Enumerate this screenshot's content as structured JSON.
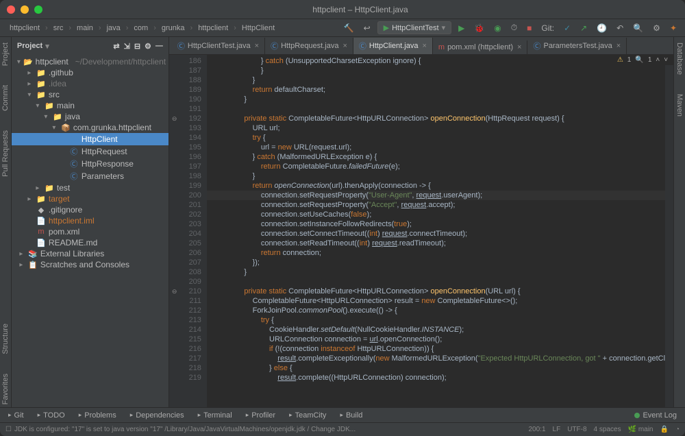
{
  "title": "httpclient – HttpClient.java",
  "breadcrumbs": [
    "httpclient",
    "src",
    "main",
    "java",
    "com",
    "grunka",
    "httpclient",
    "HttpClient"
  ],
  "run_config": "HttpClientTest",
  "git_label": "Git:",
  "left_gutter": [
    "Project",
    "Commit",
    "Pull Requests"
  ],
  "right_gutter": [
    "Database",
    "Maven"
  ],
  "left_gutter_lower": [
    "Favorites",
    "Structure"
  ],
  "sidebar": {
    "header": "Project",
    "tree": [
      {
        "depth": 0,
        "arrow": "▾",
        "icon": "📂",
        "label": "httpclient",
        "suffix": "~/Development/httpclient",
        "cls": "bold"
      },
      {
        "depth": 1,
        "arrow": "▸",
        "icon": "📁",
        "label": ".github"
      },
      {
        "depth": 1,
        "arrow": "▸",
        "icon": "📁",
        "label": ".idea",
        "dim": true
      },
      {
        "depth": 1,
        "arrow": "▾",
        "icon": "📁",
        "label": "src"
      },
      {
        "depth": 2,
        "arrow": "▾",
        "icon": "📁",
        "label": "main"
      },
      {
        "depth": 3,
        "arrow": "▾",
        "icon": "📁",
        "label": "java",
        "blue": true
      },
      {
        "depth": 4,
        "arrow": "▾",
        "icon": "📦",
        "label": "com.grunka.httpclient"
      },
      {
        "depth": 5,
        "arrow": "",
        "icon": "Ⓒ",
        "label": "HttpClient",
        "selected": true
      },
      {
        "depth": 5,
        "arrow": "",
        "icon": "Ⓒ",
        "label": "HttpRequest"
      },
      {
        "depth": 5,
        "arrow": "",
        "icon": "Ⓒ",
        "label": "HttpResponse"
      },
      {
        "depth": 5,
        "arrow": "",
        "icon": "Ⓒ",
        "label": "Parameters"
      },
      {
        "depth": 2,
        "arrow": "▸",
        "icon": "📁",
        "label": "test"
      },
      {
        "depth": 1,
        "arrow": "▸",
        "icon": "📁",
        "label": "target",
        "orange": true
      },
      {
        "depth": 1,
        "arrow": "",
        "icon": "◆",
        "label": ".gitignore"
      },
      {
        "depth": 1,
        "arrow": "",
        "icon": "📄",
        "label": "httpclient.iml",
        "orange": true
      },
      {
        "depth": 1,
        "arrow": "",
        "icon": "m",
        "label": "pom.xml"
      },
      {
        "depth": 1,
        "arrow": "",
        "icon": "📄",
        "label": "README.md"
      },
      {
        "depth": 0,
        "arrow": "▸",
        "icon": "📚",
        "label": "External Libraries"
      },
      {
        "depth": 0,
        "arrow": "▸",
        "icon": "📋",
        "label": "Scratches and Consoles"
      }
    ]
  },
  "tabs": [
    {
      "icon": "Ⓒ",
      "label": "HttpClientTest.java",
      "active": false
    },
    {
      "icon": "Ⓒ",
      "label": "HttpRequest.java",
      "active": false
    },
    {
      "icon": "Ⓒ",
      "label": "HttpClient.java",
      "active": true
    },
    {
      "icon": "m",
      "label": "pom.xml (httpclient)",
      "active": false
    },
    {
      "icon": "Ⓒ",
      "label": "ParametersTest.java",
      "active": false
    }
  ],
  "inspect": {
    "warn_count": "1",
    "search_count": "1"
  },
  "line_start": 186,
  "code": [
    {
      "n": 186,
      "txt": "                } <kw>catch</kw> (UnsupportedCharsetException ignore) {"
    },
    {
      "n": 187,
      "txt": "                }"
    },
    {
      "n": 188,
      "txt": "            }"
    },
    {
      "n": 189,
      "txt": "            <kw>return</kw> defaultCharset;"
    },
    {
      "n": 190,
      "txt": "        }"
    },
    {
      "n": 191,
      "txt": ""
    },
    {
      "n": 192,
      "fold": "⊖",
      "txt": "        <kw>private static</kw> CompletableFuture&lt;HttpURLConnection&gt; <fn>openConnection</fn>(HttpRequest request) {"
    },
    {
      "n": 193,
      "txt": "            URL url;"
    },
    {
      "n": 194,
      "txt": "            <kw>try</kw> {"
    },
    {
      "n": 195,
      "txt": "                url = <kw>new</kw> URL(request.<param>url</param>);"
    },
    {
      "n": 196,
      "txt": "            } <kw>catch</kw> (MalformedURLException e) {"
    },
    {
      "n": 197,
      "txt": "                <kw>return</kw> CompletableFuture.<it>failedFuture</it>(e);"
    },
    {
      "n": 198,
      "txt": "            }"
    },
    {
      "n": 199,
      "txt": "            <kw>return</kw> <it>openConnection</it>(url).thenApply(connection -&gt; {"
    },
    {
      "n": 200,
      "hl": true,
      "txt": "                connection.setRequestProperty(<str>\"User-Agent\"</str>, <u>request</u>.<param>userAgent</param>);"
    },
    {
      "n": 201,
      "txt": "                connection.setRequestProperty(<str>\"Accept\"</str>, <u>request</u>.<param>accept</param>);"
    },
    {
      "n": 202,
      "txt": "                connection.setUseCaches(<kw>false</kw>);"
    },
    {
      "n": 203,
      "txt": "                connection.setInstanceFollowRedirects(<kw>true</kw>);"
    },
    {
      "n": 204,
      "txt": "                connection.setConnectTimeout((<kw>int</kw>) <u>request</u>.<param>connectTimeout</param>);"
    },
    {
      "n": 205,
      "txt": "                connection.setReadTimeout((<kw>int</kw>) <u>request</u>.<param>readTimeout</param>);"
    },
    {
      "n": 206,
      "txt": "                <kw>return</kw> connection;"
    },
    {
      "n": 207,
      "txt": "            });"
    },
    {
      "n": 208,
      "txt": "        }"
    },
    {
      "n": 209,
      "txt": ""
    },
    {
      "n": 210,
      "fold": "⊖",
      "txt": "        <kw>private static</kw> CompletableFuture&lt;HttpURLConnection&gt; <fn>openConnection</fn>(URL url) {"
    },
    {
      "n": 211,
      "txt": "            CompletableFuture&lt;HttpURLConnection&gt; result = <kw>new</kw> CompletableFuture&lt;&gt;();"
    },
    {
      "n": 212,
      "txt": "            ForkJoinPool.<it>commonPool</it>().execute(() -&gt; {"
    },
    {
      "n": 213,
      "txt": "                <kw>try</kw> {"
    },
    {
      "n": 214,
      "txt": "                    CookieHandler.<it>setDefault</it>(NullCookieHandler.<it>INSTANCE</it>);"
    },
    {
      "n": 215,
      "txt": "                    URLConnection connection = <u>url</u>.openConnection();"
    },
    {
      "n": 216,
      "txt": "                    <kw>if</kw> (!(connection <kw>instanceof</kw> HttpURLConnection)) {"
    },
    {
      "n": 217,
      "txt": "                        <u>result</u>.completeExceptionally(<kw>new</kw> MalformedURLException(<str>\"Expected HttpURLConnection, got \"</str> + connection.getCl"
    },
    {
      "n": 218,
      "txt": "                    } <kw>else</kw> {"
    },
    {
      "n": 219,
      "txt": "                        <u>result</u>.complete((HttpURLConnection) connection);"
    }
  ],
  "bottom_tabs": [
    "Git",
    "TODO",
    "Problems",
    "Dependencies",
    "Terminal",
    "Profiler",
    "TeamCity",
    "Build"
  ],
  "event_log": "Event Log",
  "status_msg": "JDK is configured: \"17\" is set to java version \"17\" /Library/Java/JavaVirtualMachines/openjdk.jdk / Change JDK...",
  "status_right": {
    "pos": "200:1",
    "sep": "LF",
    "enc": "UTF-8",
    "indent": "4 spaces",
    "branch": "main"
  }
}
